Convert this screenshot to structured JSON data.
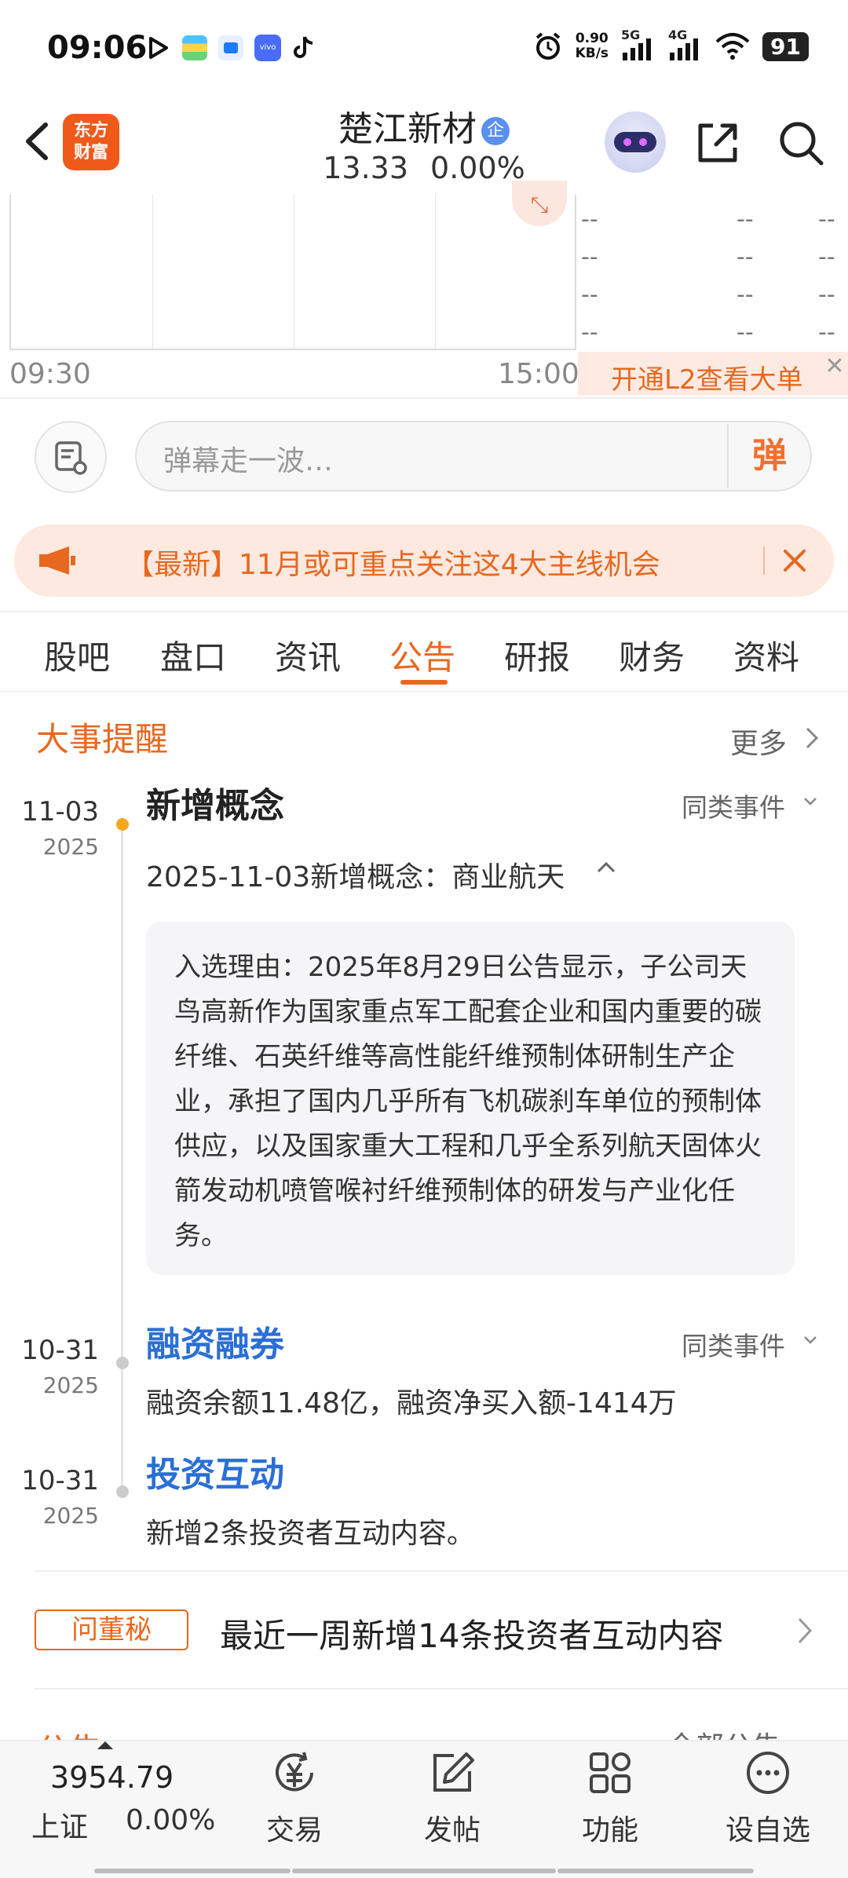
{
  "status_bar": {
    "time": "09:06",
    "net_speed_value": "0.90",
    "net_speed_unit": "KB/s",
    "signal1": "5G",
    "signal2": "4G",
    "battery": "91"
  },
  "header": {
    "logo_line1": "东方",
    "logo_line2": "财富",
    "stock_name": "楚江新材",
    "stock_badge": "企",
    "price": "13.33",
    "change_pct": "0.00%"
  },
  "chart": {
    "time_start": "09:30",
    "time_end": "15:00",
    "order_book_rows": [
      [
        "--",
        "--",
        "--"
      ],
      [
        "--",
        "--",
        "--"
      ],
      [
        "--",
        "--",
        "--"
      ],
      [
        "--",
        "--",
        "--"
      ]
    ],
    "l2_label": "开通L2查看大单"
  },
  "danmu": {
    "placeholder": "弹幕走一波…",
    "button": "弹"
  },
  "notice": {
    "text": "【最新】11月或可重点关注这4大主线机会"
  },
  "tabs": [
    "股吧",
    "盘口",
    "资讯",
    "公告",
    "研报",
    "财务",
    "资料"
  ],
  "events": {
    "section_title": "大事提醒",
    "more": "更多",
    "same_event_label": "同类事件",
    "items": [
      {
        "date": "11-03",
        "year": "2025",
        "title": "新增概念",
        "detail": "2025-11-03新增概念：商业航天",
        "reason": "入选理由：2025年8月29日公告显示，子公司天鸟高新作为国家重点军工配套企业和国内重要的碳纤维、石英纤维等高性能纤维预制体研制生产企业，承担了国内几乎所有飞机碳刹车单位的预制体供应，以及国家重大工程和几乎全系列航天固体火箭发动机喷管喉衬纤维预制体的研发与产业化任务。"
      },
      {
        "date": "10-31",
        "year": "2025",
        "title": "融资融券",
        "detail": "融资余额11.48亿，融资净买入额-1414万"
      },
      {
        "date": "10-31",
        "year": "2025",
        "title": "投资互动",
        "detail": "新增2条投资者互动内容。"
      }
    ]
  },
  "qa": {
    "badge": "问董秘",
    "text": "最近一周新增14条投资者互动内容"
  },
  "peek": {
    "title": "公告",
    "right": "全部公告"
  },
  "bottom_bar": {
    "index_value": "3954.79",
    "index_name": "上证",
    "index_change": "0.00%",
    "nav": [
      "交易",
      "发帖",
      "功能",
      "设自选"
    ]
  }
}
